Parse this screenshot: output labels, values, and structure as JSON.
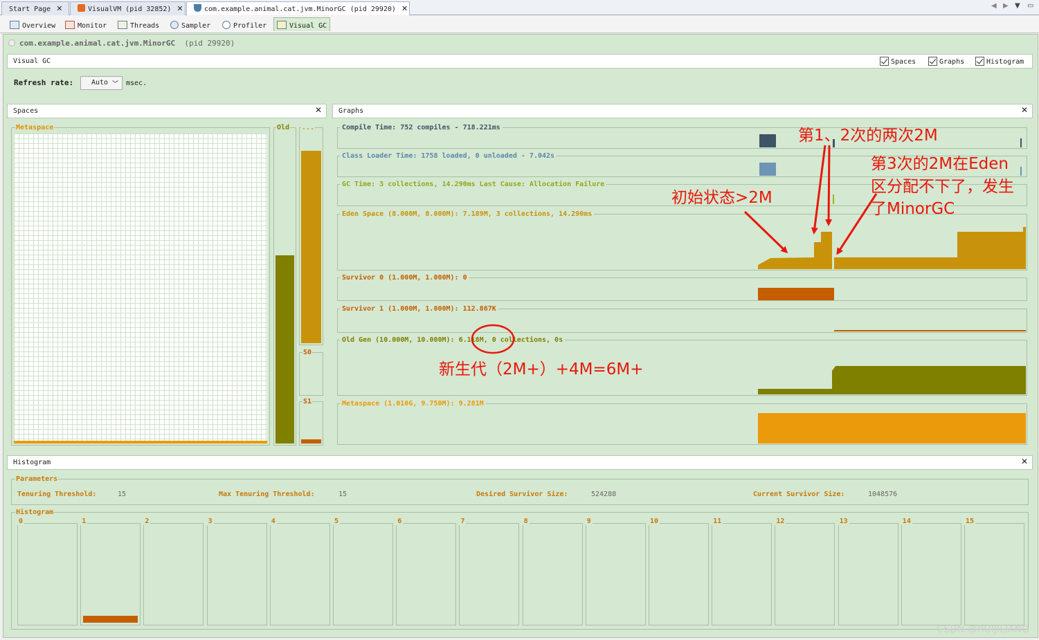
{
  "tabs": [
    {
      "label": "Start Page"
    },
    {
      "label": "VisualVM  (pid 32852)"
    },
    {
      "label": "com.example.animal.cat.jvm.MinorGC  (pid 29920)"
    }
  ],
  "subtabs": [
    "Overview",
    "Monitor",
    "Threads",
    "Sampler",
    "Profiler",
    "Visual GC"
  ],
  "process": {
    "name": "com.example.animal.cat.jvm.MinorGC",
    "pid": "(pid 29920)"
  },
  "visual_gc": {
    "title": "Visual GC",
    "checkboxes": [
      "Spaces",
      "Graphs",
      "Histogram"
    ],
    "refresh_label": "Refresh rate:",
    "refresh_value": "Auto",
    "refresh_unit": "msec."
  },
  "spaces": {
    "title": "Spaces",
    "metaspace": "Metaspace",
    "old": "Old",
    "eden_dots": "...",
    "s0": "S0",
    "s1": "S1",
    "levels": {
      "metaspace": 0.01,
      "old": 0.6,
      "eden": 0.9,
      "s0": 0,
      "s1": 0.11
    }
  },
  "graphs": {
    "title": "Graphs",
    "rows": [
      {
        "label": "Compile Time: 752 compiles - 718.221ms"
      },
      {
        "label": "Class Loader Time: 1758 loaded, 0 unloaded - 7.042s"
      },
      {
        "label": "GC Time: 3 collections, 14.290ms Last Cause: Allocation Failure"
      },
      {
        "label": "Eden Space (8.000M, 8.000M): 7.189M, 3 collections, 14.290ms"
      },
      {
        "label": "Survivor 0 (1.000M, 1.000M): 0"
      },
      {
        "label": "Survivor 1 (1.000M, 1.000M): 112.867K"
      },
      {
        "label": "Old Gen (10.000M, 10.000M): 6.118M, 0 collections, 0s"
      },
      {
        "label": "Metaspace (1.010G, 9.750M): 9.281M"
      }
    ],
    "colors": {
      "compile": "#3d5566",
      "classloader": "#6e95b4",
      "gc": "#9db328",
      "eden": "#c8930a",
      "survivor": "#c45e00",
      "old": "#7f7f00",
      "metaspace": "#eb9a0c"
    }
  },
  "annotations": {
    "a1": "第1、2次的两次2M",
    "a2": "第3次的2M在Eden",
    "a3": "区分配不下了，发生",
    "a4": "了MinorGC",
    "a5": "初始状态>2M",
    "a6": "新生代（2M+）+4M=6M+"
  },
  "histogram": {
    "title": "Histogram",
    "params_label": "Parameters",
    "params": [
      {
        "label": "Tenuring Threshold:",
        "value": "15"
      },
      {
        "label": "Max Tenuring Threshold:",
        "value": "15"
      },
      {
        "label": "Desired Survivor Size:",
        "value": "524288"
      },
      {
        "label": "Current Survivor Size:",
        "value": "1048576"
      }
    ],
    "hist_label": "Histogram",
    "bins": [
      "0",
      "1",
      "2",
      "3",
      "4",
      "5",
      "6",
      "7",
      "8",
      "9",
      "10",
      "11",
      "12",
      "13",
      "14",
      "15"
    ],
    "bin_fill": [
      0,
      0.07,
      0,
      0,
      0,
      0,
      0,
      0,
      0,
      0,
      0,
      0,
      0,
      0,
      0,
      0
    ]
  },
  "watermark": "CSDN @RUIJILIANG"
}
